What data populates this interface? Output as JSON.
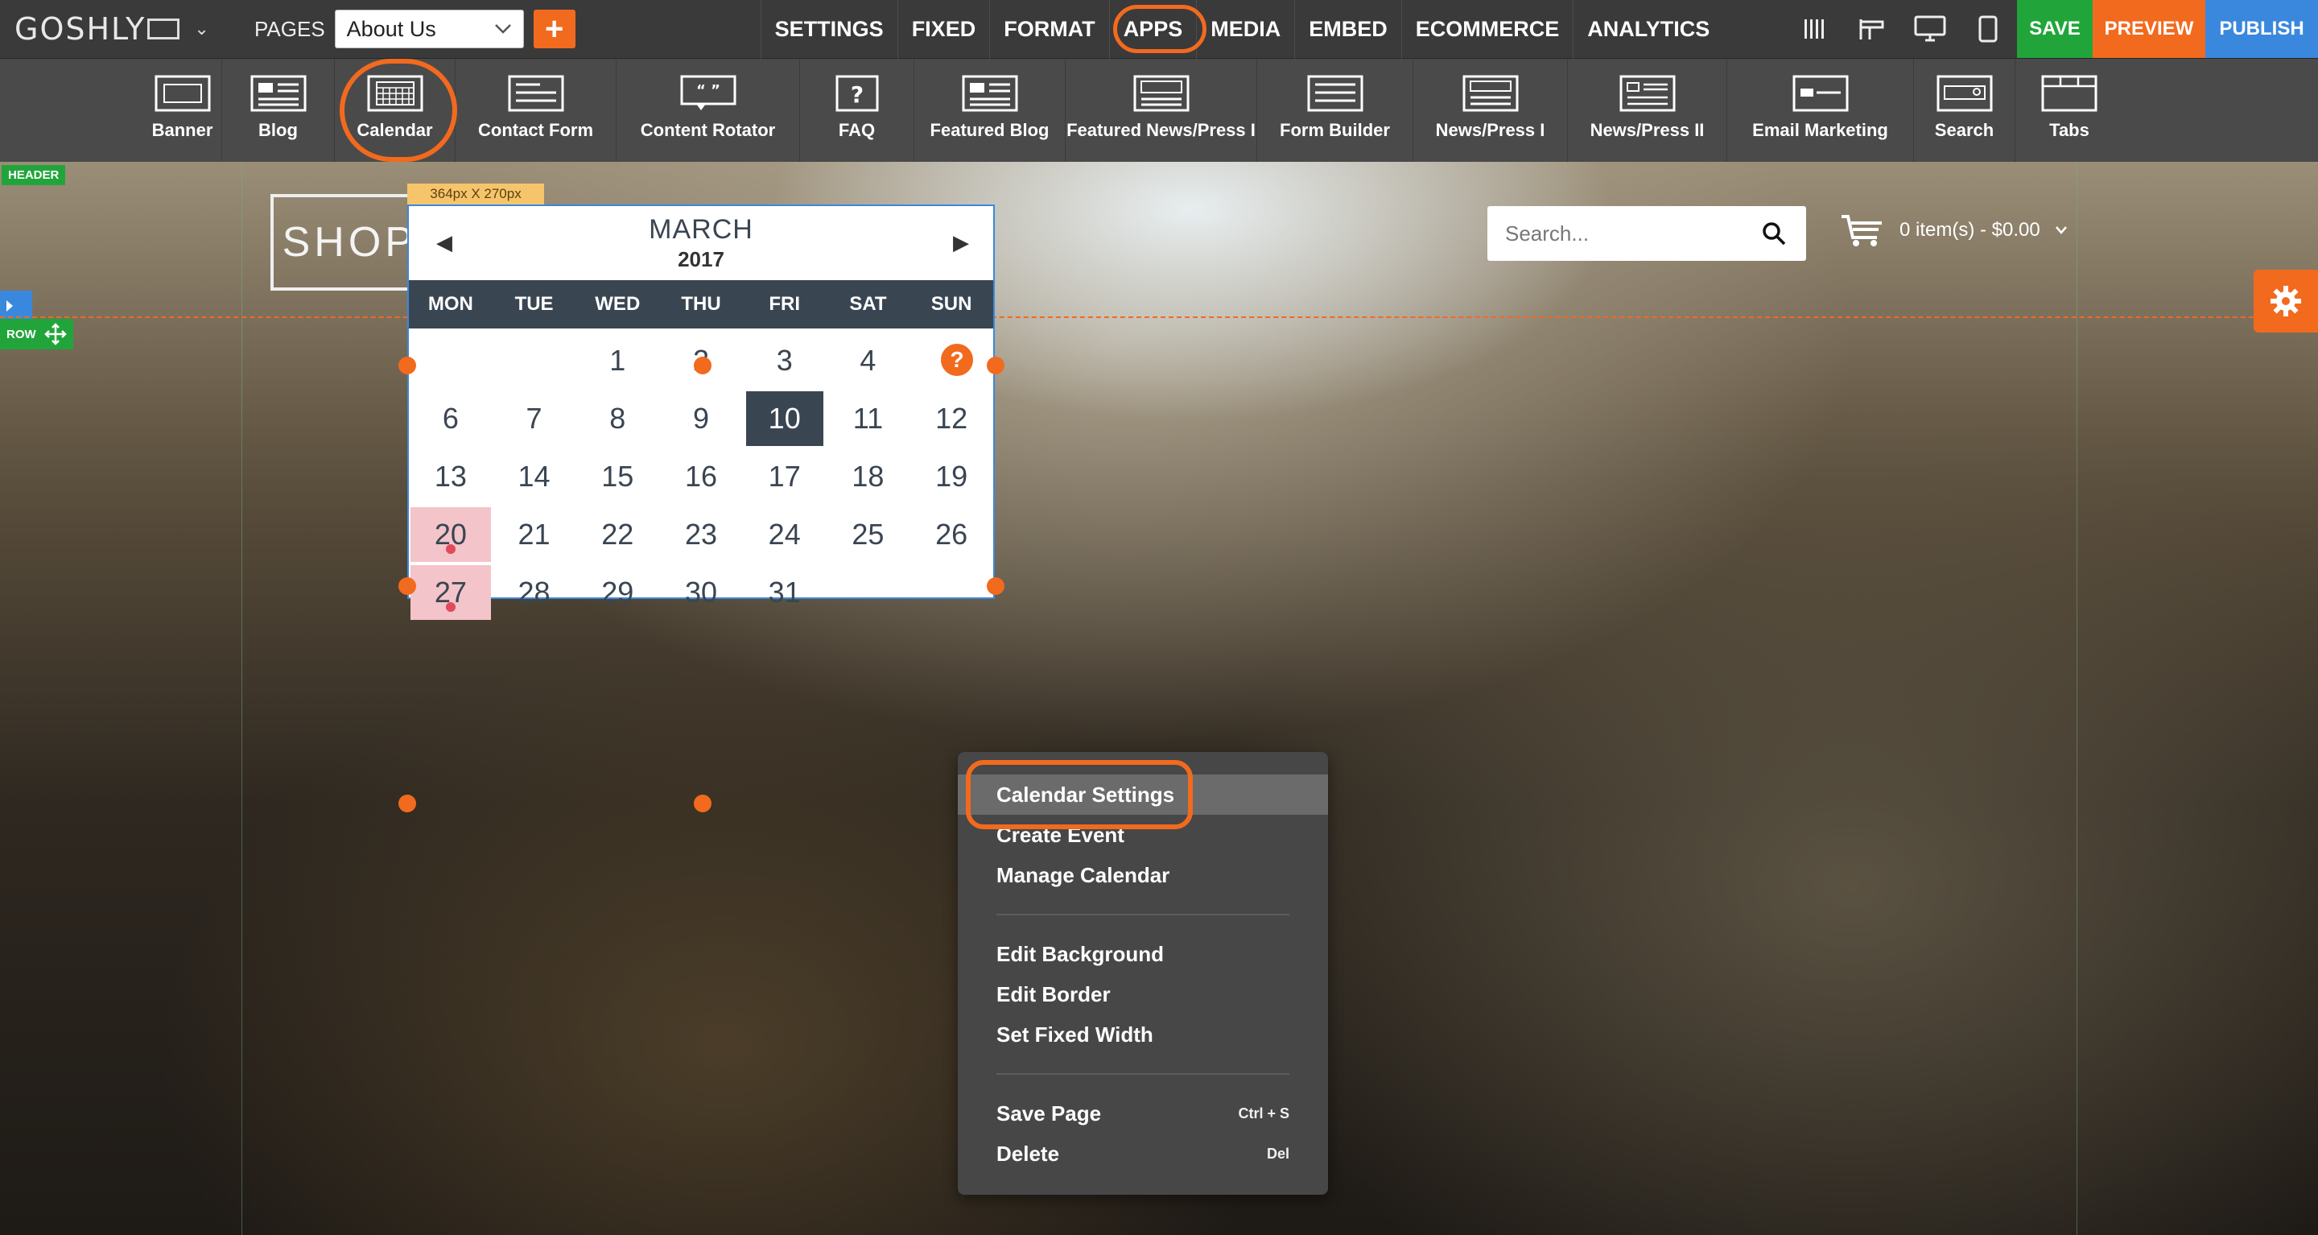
{
  "topbar": {
    "logo": "GOSHLY",
    "pages_label": "PAGES",
    "page_select": "About Us",
    "add_label": "+",
    "menu": [
      "SETTINGS",
      "FIXED",
      "FORMAT",
      "APPS",
      "MEDIA",
      "EMBED",
      "ECOMMERCE",
      "ANALYTICS"
    ],
    "tool_icons": [
      "columns-icon",
      "row-icon",
      "desktop-icon",
      "tablet-icon"
    ],
    "save": "SAVE",
    "preview": "PREVIEW",
    "publish": "PUBLISH",
    "colors": {
      "bar": "#3a3a3a",
      "save": "#21a53a",
      "preview": "#f26a1e",
      "publish": "#3a88dd",
      "highlight_ring": "#f26a1e"
    }
  },
  "appbar": {
    "items": [
      {
        "label": "Banner",
        "icon": "banner-icon"
      },
      {
        "label": "Blog",
        "icon": "blog-icon"
      },
      {
        "label": "Calendar",
        "icon": "calendar-icon"
      },
      {
        "label": "Contact Form",
        "icon": "contact-form-icon"
      },
      {
        "label": "Content Rotator",
        "icon": "content-rotator-icon"
      },
      {
        "label": "FAQ",
        "icon": "faq-icon"
      },
      {
        "label": "Featured Blog",
        "icon": "featured-blog-icon"
      },
      {
        "label": "Featured News/Press I",
        "icon": "featured-news-icon"
      },
      {
        "label": "Form Builder",
        "icon": "form-builder-icon"
      },
      {
        "label": "News/Press I",
        "icon": "news-press-1-icon"
      },
      {
        "label": "News/Press II",
        "icon": "news-press-2-icon"
      },
      {
        "label": "Email Marketing",
        "icon": "email-marketing-icon"
      },
      {
        "label": "Search",
        "icon": "search-app-icon"
      },
      {
        "label": "Tabs",
        "icon": "tabs-icon"
      }
    ]
  },
  "canvas": {
    "header_badge": "HEADER",
    "row_badge": "ROW",
    "brand": "SHOPLOID",
    "search_placeholder": "Search...",
    "cart_text": "0 item(s) - $0.00"
  },
  "calendar": {
    "size_label": "364px X 270px",
    "month": "MARCH",
    "year": "2017",
    "prev": "◀",
    "next": "▶",
    "help": "?",
    "weekdays": [
      "MON",
      "TUE",
      "WED",
      "THU",
      "FRI",
      "SAT",
      "SUN"
    ],
    "days": [
      "",
      "",
      "1",
      "2",
      "3",
      "4",
      "5",
      "6",
      "7",
      "8",
      "9",
      "10",
      "11",
      "12",
      "13",
      "14",
      "15",
      "16",
      "17",
      "18",
      "19",
      "20",
      "21",
      "22",
      "23",
      "24",
      "25",
      "26",
      "27",
      "28",
      "29",
      "30",
      "31",
      "",
      ""
    ],
    "today": "10",
    "event_days": [
      "20",
      "27"
    ],
    "colors": {
      "header": "#3a4552",
      "event": "#f3c4c9",
      "event_dot": "#e04a5b",
      "handle": "#f26a1e"
    }
  },
  "context_menu": {
    "groups": [
      [
        {
          "label": "Calendar Settings",
          "shortcut": "",
          "highlight": true
        },
        {
          "label": "Create Event",
          "shortcut": ""
        },
        {
          "label": "Manage Calendar",
          "shortcut": ""
        }
      ],
      [
        {
          "label": "Edit Background",
          "shortcut": ""
        },
        {
          "label": "Edit Border",
          "shortcut": ""
        },
        {
          "label": "Set Fixed Width",
          "shortcut": ""
        }
      ],
      [
        {
          "label": "Save Page",
          "shortcut": "Ctrl + S"
        },
        {
          "label": "Delete",
          "shortcut": "Del"
        }
      ]
    ]
  }
}
